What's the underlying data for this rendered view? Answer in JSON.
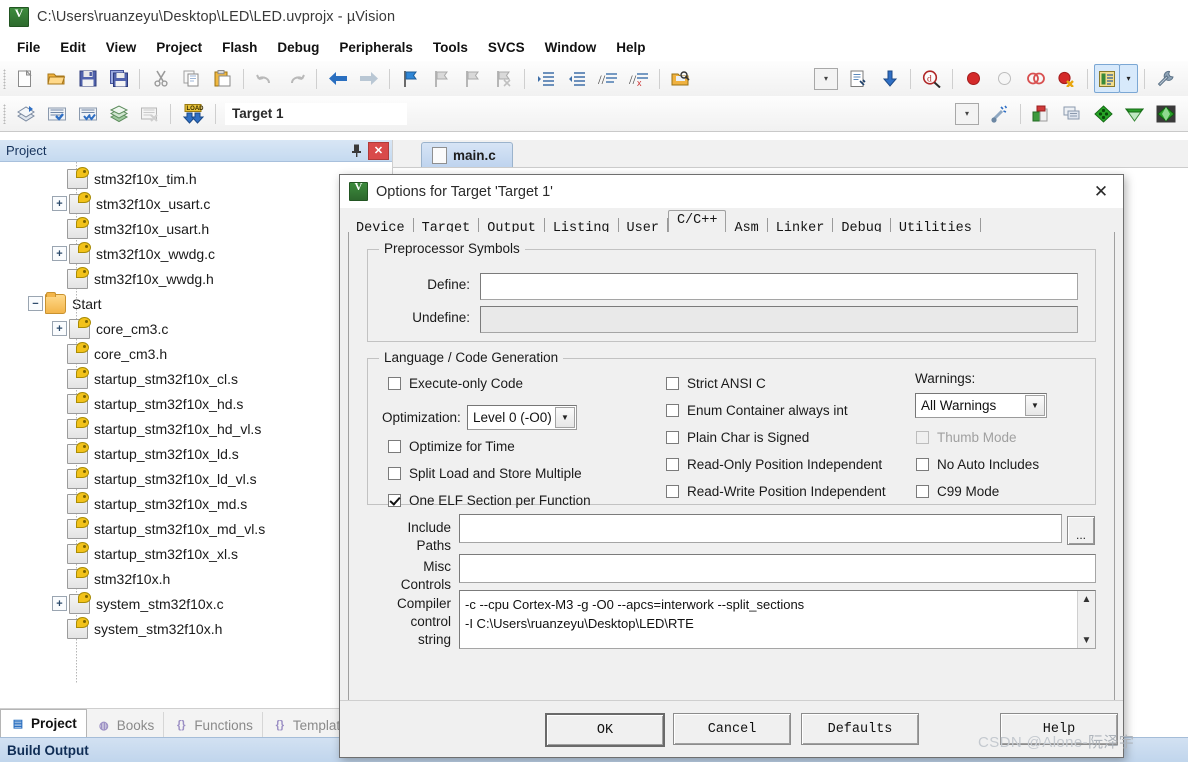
{
  "window": {
    "title": "C:\\Users\\ruanzeyu\\Desktop\\LED\\LED.uvprojx - µVision",
    "logo_icon": "uvision-logo-icon"
  },
  "menubar": {
    "items": [
      "File",
      "Edit",
      "View",
      "Project",
      "Flash",
      "Debug",
      "Peripherals",
      "Tools",
      "SVCS",
      "Window",
      "Help"
    ]
  },
  "toolbar_file": {
    "buttons": [
      {
        "name": "new-file-icon",
        "glyph": "📄"
      },
      {
        "name": "open-file-icon",
        "glyph": "📂"
      },
      {
        "name": "save-icon",
        "glyph": "💾"
      },
      {
        "name": "save-all-icon",
        "glyph": "🗃"
      },
      {
        "name": "cut-icon",
        "glyph": "✂"
      },
      {
        "name": "copy-icon",
        "glyph": "⧉"
      },
      {
        "name": "paste-icon",
        "glyph": "📋"
      },
      {
        "name": "undo-icon",
        "glyph": "↶"
      },
      {
        "name": "redo-icon",
        "glyph": "↷"
      },
      {
        "name": "navigate-back-icon",
        "glyph": "⬅"
      },
      {
        "name": "navigate-forward-icon",
        "glyph": "➡"
      },
      {
        "name": "bookmark-toggle-icon",
        "glyph": "⚑"
      },
      {
        "name": "bookmark-prev-icon",
        "glyph": "⚐"
      },
      {
        "name": "bookmark-next-icon",
        "glyph": "⚐"
      },
      {
        "name": "bookmark-clear-icon",
        "glyph": "⚐"
      },
      {
        "name": "indent-right-icon",
        "glyph": "⇥"
      },
      {
        "name": "indent-left-icon",
        "glyph": "⇤"
      },
      {
        "name": "comment-lines-icon",
        "glyph": "//"
      },
      {
        "name": "uncomment-lines-icon",
        "glyph": "//"
      },
      {
        "name": "open-folder-browse-icon",
        "glyph": "🗂"
      }
    ],
    "right_buttons": [
      {
        "name": "config-wizard-dropdown-icon",
        "glyph": "⌄"
      },
      {
        "name": "configuration-wizard-icon",
        "glyph": "📄"
      },
      {
        "name": "download-to-flash-icon",
        "glyph": "⬇"
      },
      {
        "name": "debug-session-icon",
        "glyph": "🔍"
      },
      {
        "name": "insert-breakpoint-icon",
        "glyph": "●"
      },
      {
        "name": "kill-breakpoint-icon",
        "glyph": "○"
      },
      {
        "name": "disable-breakpoint-icon",
        "glyph": "◌"
      },
      {
        "name": "kill-all-breakpoints-icon",
        "glyph": "●"
      },
      {
        "name": "manage-windows-icon",
        "glyph": "▤"
      },
      {
        "name": "manage-windows-dropdown-icon",
        "glyph": "▾"
      },
      {
        "name": "configure-tools-icon",
        "glyph": "🔧"
      }
    ]
  },
  "toolbar_build": {
    "buttons": [
      {
        "name": "translate-file-icon",
        "glyph": "◈"
      },
      {
        "name": "build-target-icon",
        "glyph": "▦"
      },
      {
        "name": "rebuild-all-icon",
        "glyph": "▩"
      },
      {
        "name": "batch-build-icon",
        "glyph": "▤"
      },
      {
        "name": "stop-build-icon",
        "glyph": "▣"
      },
      {
        "name": "download-load-icon",
        "glyph": "LOAD"
      }
    ],
    "target_selector": {
      "name": "target-combo",
      "value": "Target 1"
    },
    "right_buttons": [
      {
        "name": "target-options-dropdown-icon",
        "glyph": "⌄"
      },
      {
        "name": "start-stop-debug-icon",
        "glyph": "✦"
      },
      {
        "name": "options-for-target-icon",
        "glyph": "▮"
      },
      {
        "name": "manage-project-items-icon",
        "glyph": "▤"
      },
      {
        "name": "manage-rte-green-icon",
        "glyph": "◆"
      },
      {
        "name": "pack-installer-icon",
        "glyph": "◇"
      },
      {
        "name": "manage-multi-project-icon",
        "glyph": "◈"
      }
    ]
  },
  "project_panel": {
    "title": "Project",
    "pin_icon": "pin-icon",
    "close_icon": "close-icon",
    "tree": [
      {
        "label": "stm32f10x_tim.h",
        "depth": 3,
        "expander": "none",
        "icon": "file-h-icon"
      },
      {
        "label": "stm32f10x_usart.c",
        "depth": 3,
        "expander": "collapsed",
        "icon": "file-c-icon"
      },
      {
        "label": "stm32f10x_usart.h",
        "depth": 3,
        "expander": "none",
        "icon": "file-h-icon"
      },
      {
        "label": "stm32f10x_wwdg.c",
        "depth": 3,
        "expander": "collapsed",
        "icon": "file-c-icon"
      },
      {
        "label": "stm32f10x_wwdg.h",
        "depth": 3,
        "expander": "none",
        "icon": "file-h-icon"
      },
      {
        "label": "Start",
        "depth": 2,
        "expander": "expanded",
        "icon": "folder-icon"
      },
      {
        "label": "core_cm3.c",
        "depth": 3,
        "expander": "collapsed",
        "icon": "file-c-icon"
      },
      {
        "label": "core_cm3.h",
        "depth": 3,
        "expander": "none",
        "icon": "file-h-icon"
      },
      {
        "label": "startup_stm32f10x_cl.s",
        "depth": 3,
        "expander": "none",
        "icon": "file-s-icon"
      },
      {
        "label": "startup_stm32f10x_hd.s",
        "depth": 3,
        "expander": "none",
        "icon": "file-s-icon"
      },
      {
        "label": "startup_stm32f10x_hd_vl.s",
        "depth": 3,
        "expander": "none",
        "icon": "file-s-icon"
      },
      {
        "label": "startup_stm32f10x_ld.s",
        "depth": 3,
        "expander": "none",
        "icon": "file-s-icon"
      },
      {
        "label": "startup_stm32f10x_ld_vl.s",
        "depth": 3,
        "expander": "none",
        "icon": "file-s-icon"
      },
      {
        "label": "startup_stm32f10x_md.s",
        "depth": 3,
        "expander": "none",
        "icon": "file-s-icon"
      },
      {
        "label": "startup_stm32f10x_md_vl.s",
        "depth": 3,
        "expander": "none",
        "icon": "file-s-icon"
      },
      {
        "label": "startup_stm32f10x_xl.s",
        "depth": 3,
        "expander": "none",
        "icon": "file-s-icon"
      },
      {
        "label": "stm32f10x.h",
        "depth": 3,
        "expander": "none",
        "icon": "file-h-icon"
      },
      {
        "label": "system_stm32f10x.c",
        "depth": 3,
        "expander": "collapsed",
        "icon": "file-c-icon"
      },
      {
        "label": "system_stm32f10x.h",
        "depth": 3,
        "expander": "none",
        "icon": "file-h-icon"
      }
    ]
  },
  "editor": {
    "tab_label": "main.c",
    "tab_icon": "document-icon"
  },
  "bottom_tabs": [
    {
      "label": "Project",
      "icon": "project-icon",
      "active": true,
      "glyph": "▤"
    },
    {
      "label": "Books",
      "icon": "books-icon",
      "active": false,
      "glyph": "◍"
    },
    {
      "label": "Functions",
      "icon": "functions-icon",
      "active": false,
      "glyph": "{}"
    },
    {
      "label": "Template",
      "icon": "templates-icon",
      "active": false,
      "glyph": "{}"
    }
  ],
  "status": {
    "build_output_label": "Build Output"
  },
  "dialog": {
    "title": "Options for Target 'Target 1'",
    "logo_icon": "uvision-logo-icon",
    "close_icon": "close-icon",
    "tabs": [
      {
        "label": "Device",
        "active": false
      },
      {
        "label": "Target",
        "active": false
      },
      {
        "label": "Output",
        "active": false
      },
      {
        "label": "Listing",
        "active": false
      },
      {
        "label": "User",
        "active": false
      },
      {
        "label": "C/C++",
        "active": true
      },
      {
        "label": "Asm",
        "active": false
      },
      {
        "label": "Linker",
        "active": false
      },
      {
        "label": "Debug",
        "active": false
      },
      {
        "label": "Utilities",
        "active": false
      }
    ],
    "preprocessor": {
      "legend": "Preprocessor Symbols",
      "define_label": "Define:",
      "define_value": "",
      "undefine_label": "Undefine:",
      "undefine_value": "",
      "undefine_disabled": true
    },
    "language": {
      "legend": "Language / Code Generation",
      "left_checks": [
        {
          "label": "Execute-only Code",
          "checked": false,
          "disabled": false
        },
        {
          "label": "Optimize for Time",
          "checked": false,
          "disabled": false
        },
        {
          "label": "Split Load and Store Multiple",
          "checked": false,
          "disabled": false
        },
        {
          "label": "One ELF Section per Function",
          "checked": true,
          "disabled": false
        }
      ],
      "optimization_label": "Optimization:",
      "optimization_value": "Level 0 (-O0)",
      "mid_checks": [
        {
          "label": "Strict ANSI C",
          "checked": false,
          "disabled": false
        },
        {
          "label": "Enum Container always int",
          "checked": false,
          "disabled": false
        },
        {
          "label": "Plain Char is Signed",
          "checked": false,
          "disabled": false
        },
        {
          "label": "Read-Only Position Independent",
          "checked": false,
          "disabled": false
        },
        {
          "label": "Read-Write Position Independent",
          "checked": false,
          "disabled": false
        }
      ],
      "warnings_label": "Warnings:",
      "warnings_value": "All Warnings",
      "right_checks": [
        {
          "label": "Thumb Mode",
          "checked": false,
          "disabled": true
        },
        {
          "label": "No Auto Includes",
          "checked": false,
          "disabled": false
        },
        {
          "label": "C99 Mode",
          "checked": false,
          "disabled": false
        }
      ]
    },
    "paths": {
      "include_label_line1": "Include",
      "include_label_line2": "Paths",
      "include_value": "",
      "browse_label": "...",
      "misc_label_line1": "Misc",
      "misc_label_line2": "Controls",
      "misc_value": "",
      "compiler_label_line1": "Compiler",
      "compiler_label_line2": "control",
      "compiler_label_line3": "string",
      "compiler_value": "-c --cpu Cortex-M3 -g -O0 --apcs=interwork --split_sections\n-I C:\\Users\\ruanzeyu\\Desktop\\LED\\RTE",
      "scroll_up_icon": "scroll-up-icon",
      "scroll_down_icon": "scroll-down-icon"
    },
    "buttons": [
      {
        "label": "OK",
        "default": true
      },
      {
        "label": "Cancel",
        "default": false
      },
      {
        "label": "Defaults",
        "default": false
      },
      {
        "label": "Help",
        "default": false
      }
    ]
  },
  "watermark": {
    "prefix": "CSDN @Alone-",
    "cn": "阮泽宇"
  }
}
